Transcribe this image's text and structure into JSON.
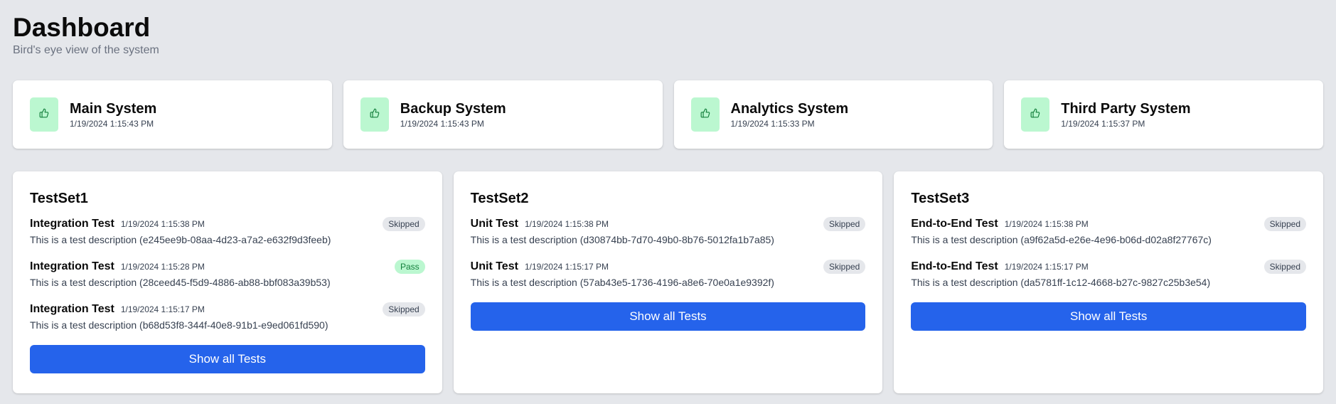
{
  "header": {
    "title": "Dashboard",
    "subtitle": "Bird's eye view of the system"
  },
  "systems": [
    {
      "name": "Main System",
      "time": "1/19/2024 1:15:43 PM",
      "icon": "thumbs-up-icon",
      "status_color": "#bbf7d0"
    },
    {
      "name": "Backup System",
      "time": "1/19/2024 1:15:43 PM",
      "icon": "thumbs-up-icon",
      "status_color": "#bbf7d0"
    },
    {
      "name": "Analytics System",
      "time": "1/19/2024 1:15:33 PM",
      "icon": "thumbs-up-icon",
      "status_color": "#bbf7d0"
    },
    {
      "name": "Third Party System",
      "time": "1/19/2024 1:15:37 PM",
      "icon": "thumbs-up-icon",
      "status_color": "#bbf7d0"
    }
  ],
  "testsets": [
    {
      "title": "TestSet1",
      "button_label": "Show all Tests",
      "tests": [
        {
          "name": "Integration Test",
          "time": "1/19/2024 1:15:38 PM",
          "status": "Skipped",
          "description": "This is a test description (e245ee9b-08aa-4d23-a7a2-e632f9d3feeb)"
        },
        {
          "name": "Integration Test",
          "time": "1/19/2024 1:15:28 PM",
          "status": "Pass",
          "description": "This is a test description (28ceed45-f5d9-4886-ab88-bbf083a39b53)"
        },
        {
          "name": "Integration Test",
          "time": "1/19/2024 1:15:17 PM",
          "status": "Skipped",
          "description": "This is a test description (b68d53f8-344f-40e8-91b1-e9ed061fd590)"
        }
      ]
    },
    {
      "title": "TestSet2",
      "button_label": "Show all Tests",
      "tests": [
        {
          "name": "Unit Test",
          "time": "1/19/2024 1:15:38 PM",
          "status": "Skipped",
          "description": "This is a test description (d30874bb-7d70-49b0-8b76-5012fa1b7a85)"
        },
        {
          "name": "Unit Test",
          "time": "1/19/2024 1:15:17 PM",
          "status": "Skipped",
          "description": "This is a test description (57ab43e5-1736-4196-a8e6-70e0a1e9392f)"
        }
      ]
    },
    {
      "title": "TestSet3",
      "button_label": "Show all Tests",
      "tests": [
        {
          "name": "End-to-End Test",
          "time": "1/19/2024 1:15:38 PM",
          "status": "Skipped",
          "description": "This is a test description (a9f62a5d-e26e-4e96-b06d-d02a8f27767c)"
        },
        {
          "name": "End-to-End Test",
          "time": "1/19/2024 1:15:17 PM",
          "status": "Skipped",
          "description": "This is a test description (da5781ff-1c12-4668-b27c-9827c25b3e54)"
        }
      ]
    }
  ],
  "colors": {
    "accent": "#2563eb",
    "pass_badge": "#bbf7d0",
    "skipped_badge": "#e5e7eb"
  }
}
